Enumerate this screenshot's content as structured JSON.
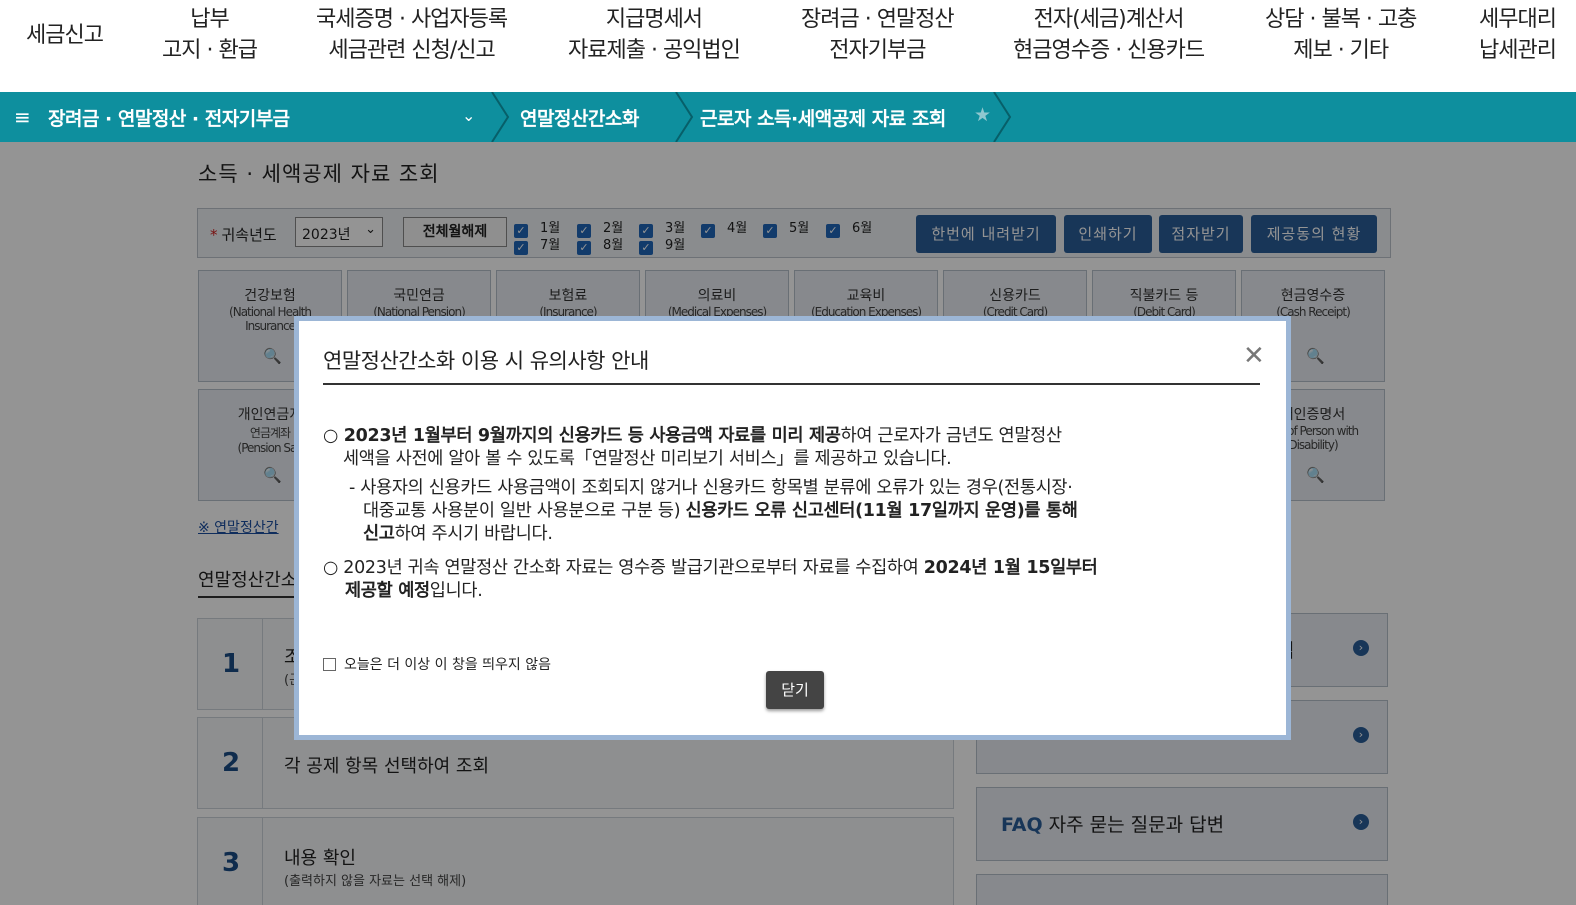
{
  "top_nav": [
    {
      "line1": "세금신고",
      "line2": ""
    },
    {
      "line1": "납부",
      "line2": "고지 · 환급"
    },
    {
      "line1": "국세증명 · 사업자등록",
      "line2": "세금관련 신청/신고"
    },
    {
      "line1": "지급명세서",
      "line2": "자료제출 · 공익법인"
    },
    {
      "line1": "장려금 · 연말정산",
      "line2": "전자기부금"
    },
    {
      "line1": "전자(세금)계산서",
      "line2": "현금영수증 · 신용카드"
    },
    {
      "line1": "상담 · 불복 · 고충",
      "line2": "제보 · 기타"
    },
    {
      "line1": "세무대리",
      "line2": "납세관리"
    }
  ],
  "breadcrumb": {
    "menu_icon": "hamburger-icon",
    "level1": "장려금 · 연말정산 · 전자기부금",
    "level2": "연말정산간소화",
    "level3": "근로자 소득·세액공제 자료 조회",
    "favorite_icon": "star-icon"
  },
  "page": {
    "title": "소득 · 세액공제 자료 조회",
    "filter": {
      "year_label": "귀속년도",
      "year_value": "2023년",
      "clear_all": "전체월해제",
      "months": [
        "1월",
        "2월",
        "3월",
        "4월",
        "5월",
        "6월",
        "7월",
        "8월",
        "9월"
      ],
      "buttons": [
        "한번에 내려받기",
        "인쇄하기",
        "점자받기",
        "제공동의 현황"
      ]
    },
    "cards": [
      {
        "title": "건강보험",
        "sub": "(National Health",
        "sub2": "Insurance"
      },
      {
        "title": "국민연금",
        "sub": "(National Pension)",
        "sub2": ""
      },
      {
        "title": "보험료",
        "sub": "(Insurance)",
        "sub2": ""
      },
      {
        "title": "의료비",
        "sub": "(Medical Expenses)",
        "sub2": ""
      },
      {
        "title": "교육비",
        "sub": "(Education Expenses)",
        "sub2": ""
      },
      {
        "title": "신용카드",
        "sub": "(Credit Card)",
        "sub2": ""
      },
      {
        "title": "직불카드 등",
        "sub": "(Debit Card)",
        "sub2": ""
      },
      {
        "title": "현금영수증",
        "sub": "(Cash Receipt)",
        "sub2": ""
      }
    ],
    "cards_row2_left": {
      "title": "개인연금저",
      "title2": "연금계좌",
      "sub": "(Pension Sav"
    },
    "cards_row2_right": {
      "title": "애인증명서",
      "sub": "ate of Person with",
      "sub2": "Disability)"
    },
    "notice_link": "※ 연말정산간",
    "section_title": "연말정산간소",
    "steps": [
      {
        "num": "1",
        "text": "조",
        "sub": "(곤"
      },
      {
        "num": "2",
        "text": "각 공제 항목 선택하여 조회",
        "sub": ""
      },
      {
        "num": "3",
        "text": "내용 확인",
        "sub": "(출력하지 않을 자료는 선택 해제)"
      }
    ],
    "right_boxes": [
      {
        "prefix": "",
        "text": "법"
      },
      {
        "prefix": "",
        "text": ""
      },
      {
        "prefix": "FAQ",
        "text": "자주 묻는 질문과 답변"
      }
    ]
  },
  "modal": {
    "title": "연말정산간소화 이용 시 유의사항 안내",
    "close_icon": "close-icon",
    "p1_a": "○ 2023년 1월부터 9월까지의 신용카드 등 사용금액 자료를 미리 제공",
    "p1_b": "하여 근로자가 금년도 연말정산",
    "p1_c": "세액을 사전에 알아 볼 수 있도록「연말정산 미리보기 서비스」를 제공하고 있습니다.",
    "p2_a": "- 사용자의 신용카드 사용금액이 조회되지 않거나 신용카드 항목별 분류에 오류가 있는 경우(전통시장·",
    "p2_b": "대중교통 사용분이 일반 사용분으로 구분 등)",
    "p2_c": "신용카드 오류 신고센터(11월 17일까지 운영)를 통해",
    "p2_d": "신고",
    "p2_e": "하여 주시기 바랍니다.",
    "p3_a": "○ 2023년 귀속 연말정산 간소화 자료는 영수증 발급기관으로부터 자료를 수집하여",
    "p3_b": "2024년 1월 15일부터",
    "p3_c": "제공할 예정",
    "p3_d": "입니다.",
    "checkbox_label": "오늘은 더 이상 이 창을 띄우지 않음",
    "ok_button": "닫기"
  }
}
